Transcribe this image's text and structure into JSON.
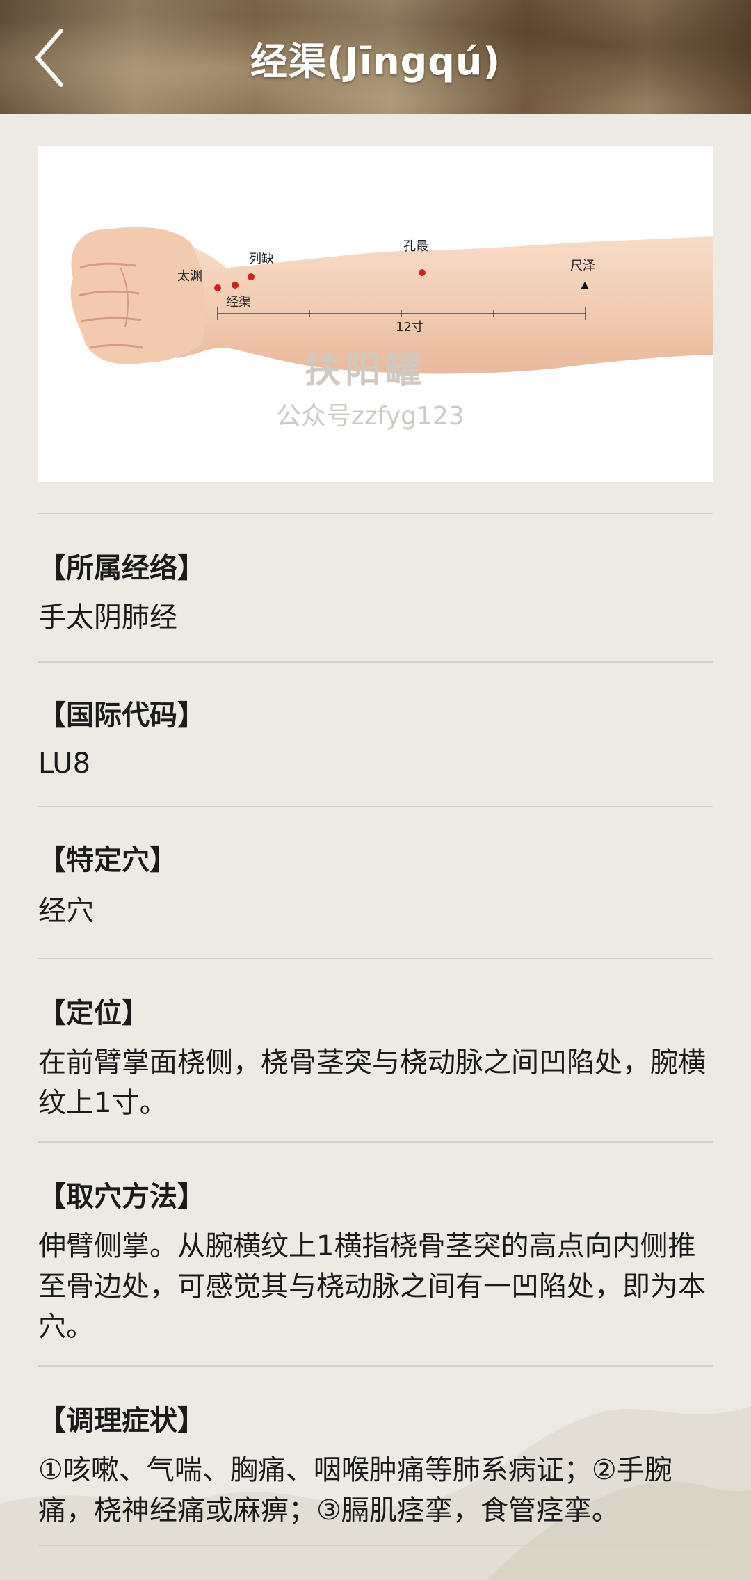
{
  "header": {
    "title": "经渠(Jīngqú)",
    "back_icon": "chevron-left-icon"
  },
  "figure": {
    "labels": {
      "taiyuan": "太渊",
      "lieque": "列缺",
      "jingqu": "经渠",
      "kongzui": "孔最",
      "chize": "尺泽",
      "measure": "12寸"
    },
    "watermark_main": "扶阳罐",
    "watermark_sub": "公众号zzfyg123"
  },
  "sections": [
    {
      "label": "【所属经络】",
      "value": "手太阴肺经"
    },
    {
      "label": "【国际代码】",
      "value": "LU8"
    },
    {
      "label": "【特定穴】",
      "value": "经穴"
    },
    {
      "label": "【定位】",
      "value": "在前臂掌面桡侧，桡骨茎突与桡动脉之间凹陷处，腕横纹上1寸。"
    },
    {
      "label": "【取穴方法】",
      "value": "伸臂侧掌。从腕横纹上1横指桡骨茎突的高点向内侧推至骨边处，可感觉其与桡动脉之间有一凹陷处，即为本穴。"
    },
    {
      "label": "【调理症状】",
      "value": "①咳嗽、气喘、胸痛、咽喉肿痛等肺系病证；②手腕痛，桡神经痛或麻痹；③膈肌痉挛，食管痉挛。"
    }
  ],
  "colors": {
    "acupoint": "#d42020",
    "background": "#eceae3"
  }
}
